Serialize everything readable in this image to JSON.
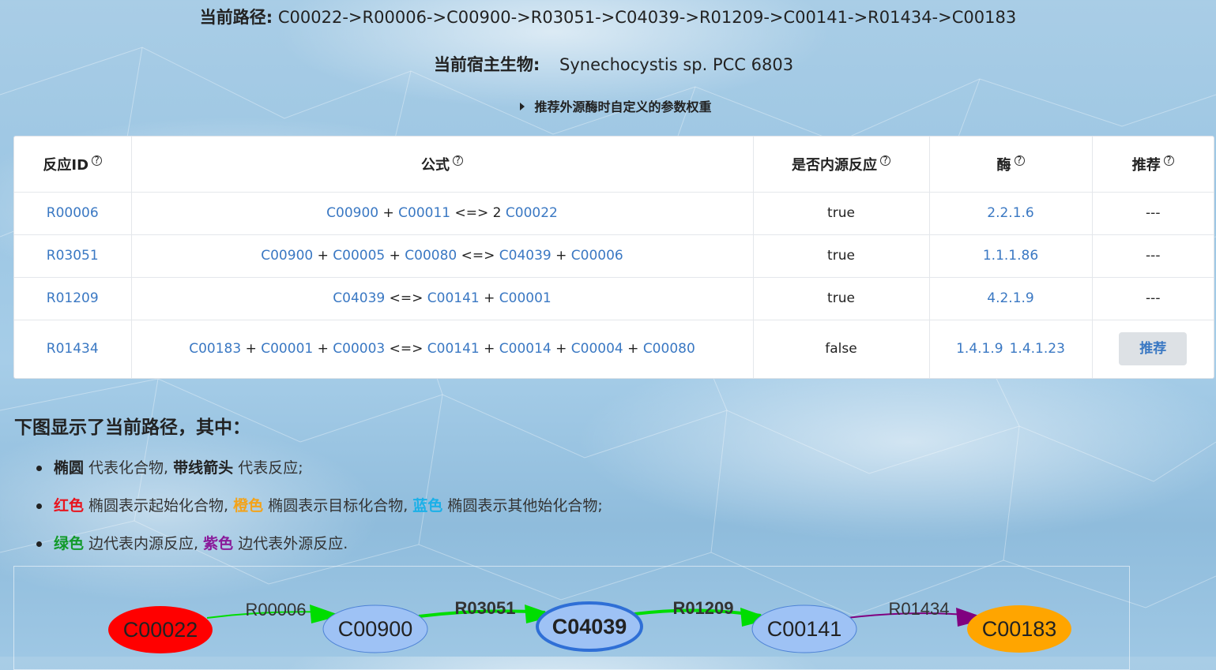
{
  "path": {
    "label": "当前路径:",
    "value": "C00022->R00006->C00900->R03051->C04039->R01209->C00141->R01434->C00183"
  },
  "host": {
    "label": "当前宿主生物:",
    "value": "Synechocystis sp. PCC 6803"
  },
  "weights_toggle": "推荐外源酶时自定义的参数权重",
  "table": {
    "headers": [
      "反应ID",
      "公式",
      "是否内源反应",
      "酶",
      "推荐"
    ],
    "help_glyph": "?",
    "rows": [
      {
        "id": "R00006",
        "formula": [
          "C00900",
          " + ",
          "C00011",
          " <=> 2 ",
          "C00022"
        ],
        "endogenous": "true",
        "enzymes": [
          "2.2.1.6"
        ],
        "recommend": "---"
      },
      {
        "id": "R03051",
        "formula": [
          "C00900",
          " + ",
          "C00005",
          " + ",
          "C00080",
          " <=> ",
          "C04039",
          " + ",
          "C00006"
        ],
        "endogenous": "true",
        "enzymes": [
          "1.1.1.86"
        ],
        "recommend": "---"
      },
      {
        "id": "R01209",
        "formula": [
          "C04039",
          " <=> ",
          "C00141",
          " + ",
          "C00001"
        ],
        "endogenous": "true",
        "enzymes": [
          "4.2.1.9"
        ],
        "recommend": "---"
      },
      {
        "id": "R01434",
        "formula": [
          "C00183",
          " + ",
          "C00001",
          " + ",
          "C00003",
          " <=> ",
          "C00141",
          " + ",
          "C00014",
          " + ",
          "C00004",
          " + ",
          "C00080"
        ],
        "endogenous": "false",
        "enzymes": [
          "1.4.1.9",
          "1.4.1.23"
        ],
        "recommend": "推荐"
      }
    ]
  },
  "legend": {
    "title": "下图显示了当前路径，其中：",
    "item1": {
      "a": "椭圆",
      "b": " 代表化合物, ",
      "c": "带线箭头",
      "d": " 代表反应;"
    },
    "item2": {
      "red": "红色",
      "t1": " 椭圆表示起始化合物, ",
      "orange": "橙色",
      "t2": " 椭圆表示目标化合物, ",
      "blue": "蓝色",
      "t3": " 椭圆表示其他始化合物;"
    },
    "item3": {
      "green": "绿色",
      "t1": " 边代表内源反应, ",
      "purple": "紫色",
      "t2": " 边代表外源反应."
    }
  },
  "graph": {
    "nodes": [
      {
        "id": "C00022",
        "role": "start",
        "color": "#ff0000"
      },
      {
        "id": "C00900",
        "role": "other",
        "color": "#9ec2f5"
      },
      {
        "id": "C04039",
        "role": "other-highlight",
        "color": "#9ec2f5"
      },
      {
        "id": "C00141",
        "role": "other",
        "color": "#9ec2f5"
      },
      {
        "id": "C00183",
        "role": "target",
        "color": "#ffa500"
      }
    ],
    "edges": [
      {
        "id": "R00006",
        "type": "endogenous",
        "color": "#00dd00"
      },
      {
        "id": "R03051",
        "type": "endogenous",
        "color": "#00dd00"
      },
      {
        "id": "R01209",
        "type": "endogenous",
        "color": "#00dd00"
      },
      {
        "id": "R01434",
        "type": "exogenous",
        "color": "#800080"
      }
    ]
  },
  "colors": {
    "link": "#3a78c3",
    "red": "#e8141e",
    "orange": "#f3a31a",
    "blue": "#1bb0e8",
    "green": "#129a2a",
    "purple": "#8a1a9a"
  }
}
